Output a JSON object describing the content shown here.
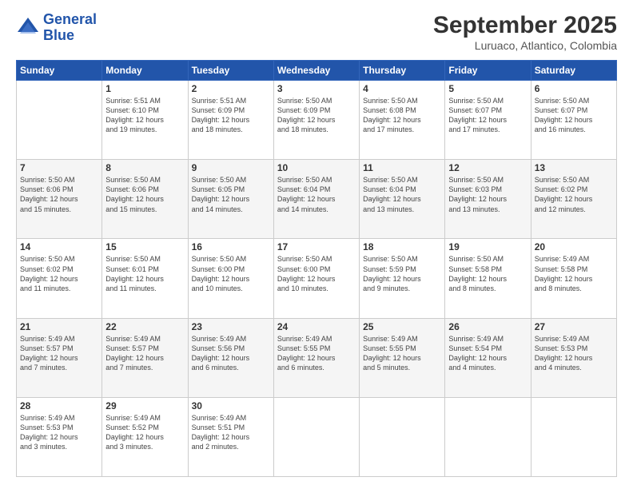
{
  "header": {
    "logo_line1": "General",
    "logo_line2": "Blue",
    "month": "September 2025",
    "location": "Luruaco, Atlantico, Colombia"
  },
  "weekdays": [
    "Sunday",
    "Monday",
    "Tuesday",
    "Wednesday",
    "Thursday",
    "Friday",
    "Saturday"
  ],
  "weeks": [
    [
      {
        "day": "",
        "info": ""
      },
      {
        "day": "1",
        "info": "Sunrise: 5:51 AM\nSunset: 6:10 PM\nDaylight: 12 hours\nand 19 minutes."
      },
      {
        "day": "2",
        "info": "Sunrise: 5:51 AM\nSunset: 6:09 PM\nDaylight: 12 hours\nand 18 minutes."
      },
      {
        "day": "3",
        "info": "Sunrise: 5:50 AM\nSunset: 6:09 PM\nDaylight: 12 hours\nand 18 minutes."
      },
      {
        "day": "4",
        "info": "Sunrise: 5:50 AM\nSunset: 6:08 PM\nDaylight: 12 hours\nand 17 minutes."
      },
      {
        "day": "5",
        "info": "Sunrise: 5:50 AM\nSunset: 6:07 PM\nDaylight: 12 hours\nand 17 minutes."
      },
      {
        "day": "6",
        "info": "Sunrise: 5:50 AM\nSunset: 6:07 PM\nDaylight: 12 hours\nand 16 minutes."
      }
    ],
    [
      {
        "day": "7",
        "info": "Sunrise: 5:50 AM\nSunset: 6:06 PM\nDaylight: 12 hours\nand 15 minutes."
      },
      {
        "day": "8",
        "info": "Sunrise: 5:50 AM\nSunset: 6:06 PM\nDaylight: 12 hours\nand 15 minutes."
      },
      {
        "day": "9",
        "info": "Sunrise: 5:50 AM\nSunset: 6:05 PM\nDaylight: 12 hours\nand 14 minutes."
      },
      {
        "day": "10",
        "info": "Sunrise: 5:50 AM\nSunset: 6:04 PM\nDaylight: 12 hours\nand 14 minutes."
      },
      {
        "day": "11",
        "info": "Sunrise: 5:50 AM\nSunset: 6:04 PM\nDaylight: 12 hours\nand 13 minutes."
      },
      {
        "day": "12",
        "info": "Sunrise: 5:50 AM\nSunset: 6:03 PM\nDaylight: 12 hours\nand 13 minutes."
      },
      {
        "day": "13",
        "info": "Sunrise: 5:50 AM\nSunset: 6:02 PM\nDaylight: 12 hours\nand 12 minutes."
      }
    ],
    [
      {
        "day": "14",
        "info": "Sunrise: 5:50 AM\nSunset: 6:02 PM\nDaylight: 12 hours\nand 11 minutes."
      },
      {
        "day": "15",
        "info": "Sunrise: 5:50 AM\nSunset: 6:01 PM\nDaylight: 12 hours\nand 11 minutes."
      },
      {
        "day": "16",
        "info": "Sunrise: 5:50 AM\nSunset: 6:00 PM\nDaylight: 12 hours\nand 10 minutes."
      },
      {
        "day": "17",
        "info": "Sunrise: 5:50 AM\nSunset: 6:00 PM\nDaylight: 12 hours\nand 10 minutes."
      },
      {
        "day": "18",
        "info": "Sunrise: 5:50 AM\nSunset: 5:59 PM\nDaylight: 12 hours\nand 9 minutes."
      },
      {
        "day": "19",
        "info": "Sunrise: 5:50 AM\nSunset: 5:58 PM\nDaylight: 12 hours\nand 8 minutes."
      },
      {
        "day": "20",
        "info": "Sunrise: 5:49 AM\nSunset: 5:58 PM\nDaylight: 12 hours\nand 8 minutes."
      }
    ],
    [
      {
        "day": "21",
        "info": "Sunrise: 5:49 AM\nSunset: 5:57 PM\nDaylight: 12 hours\nand 7 minutes."
      },
      {
        "day": "22",
        "info": "Sunrise: 5:49 AM\nSunset: 5:57 PM\nDaylight: 12 hours\nand 7 minutes."
      },
      {
        "day": "23",
        "info": "Sunrise: 5:49 AM\nSunset: 5:56 PM\nDaylight: 12 hours\nand 6 minutes."
      },
      {
        "day": "24",
        "info": "Sunrise: 5:49 AM\nSunset: 5:55 PM\nDaylight: 12 hours\nand 6 minutes."
      },
      {
        "day": "25",
        "info": "Sunrise: 5:49 AM\nSunset: 5:55 PM\nDaylight: 12 hours\nand 5 minutes."
      },
      {
        "day": "26",
        "info": "Sunrise: 5:49 AM\nSunset: 5:54 PM\nDaylight: 12 hours\nand 4 minutes."
      },
      {
        "day": "27",
        "info": "Sunrise: 5:49 AM\nSunset: 5:53 PM\nDaylight: 12 hours\nand 4 minutes."
      }
    ],
    [
      {
        "day": "28",
        "info": "Sunrise: 5:49 AM\nSunset: 5:53 PM\nDaylight: 12 hours\nand 3 minutes."
      },
      {
        "day": "29",
        "info": "Sunrise: 5:49 AM\nSunset: 5:52 PM\nDaylight: 12 hours\nand 3 minutes."
      },
      {
        "day": "30",
        "info": "Sunrise: 5:49 AM\nSunset: 5:51 PM\nDaylight: 12 hours\nand 2 minutes."
      },
      {
        "day": "",
        "info": ""
      },
      {
        "day": "",
        "info": ""
      },
      {
        "day": "",
        "info": ""
      },
      {
        "day": "",
        "info": ""
      }
    ]
  ]
}
